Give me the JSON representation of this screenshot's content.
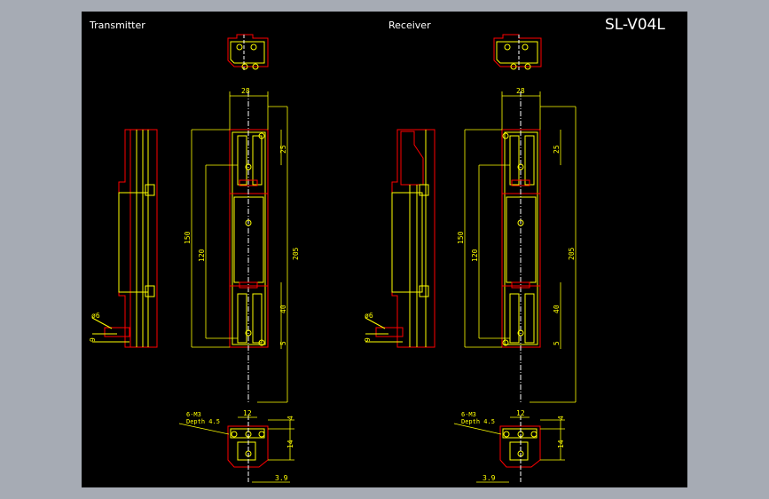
{
  "drawing": {
    "model": "SL-V04L",
    "transmitter_label": "Transmitter",
    "receiver_label": "Receiver"
  },
  "dimensions": {
    "width_top": "28",
    "pitch_top": "25",
    "height_total": "150",
    "inner_length": "120",
    "overall_length": "205",
    "pitch_bottom": "40",
    "bottom_margin": "5",
    "hole_diameter": "ø6",
    "side_offset": "9",
    "mount_thread": "6-M3",
    "mount_depth": "Depth 4.5",
    "base_width": "12",
    "base_top": "4",
    "base_height": "14",
    "base_offset": "3.9"
  },
  "colors": {
    "background": "#000000",
    "frame": "#a6abb4",
    "outline": "#ff0000",
    "dimension": "#ffff00",
    "centerline": "#ffffff",
    "text": "#ffffff"
  }
}
